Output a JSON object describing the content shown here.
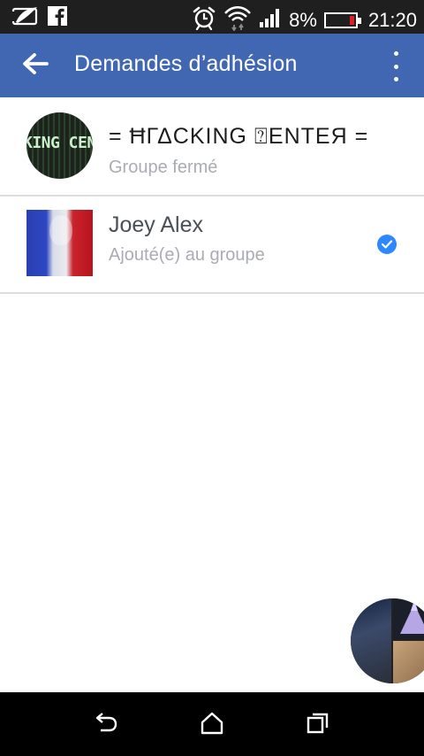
{
  "status_bar": {
    "battery_percent": "8%",
    "time": "21:20",
    "battery_level": 0.08,
    "battery_color": "#e02020",
    "icons": [
      "clipboard-icon",
      "facebook-icon",
      "alarm-icon",
      "wifi-icon",
      "signal-icon",
      "battery-icon"
    ]
  },
  "app_bar": {
    "title": "Demandes d’adhésion",
    "color": "#4267b2",
    "back_icon": "arrow-left-icon",
    "menu_icon": "more-vert-icon"
  },
  "group": {
    "name": "= ĦΓΔCKING ⍰ENTEЯ =",
    "subtitle": "Groupe fermé",
    "avatar_text": "KING CEN"
  },
  "members": [
    {
      "name": "Joey Alex",
      "status": "Ajouté(e) au groupe",
      "checked": true,
      "check_color": "#2d88ff"
    }
  ],
  "nav_bar": {
    "icons": [
      "back-icon",
      "home-icon",
      "recents-icon"
    ]
  }
}
